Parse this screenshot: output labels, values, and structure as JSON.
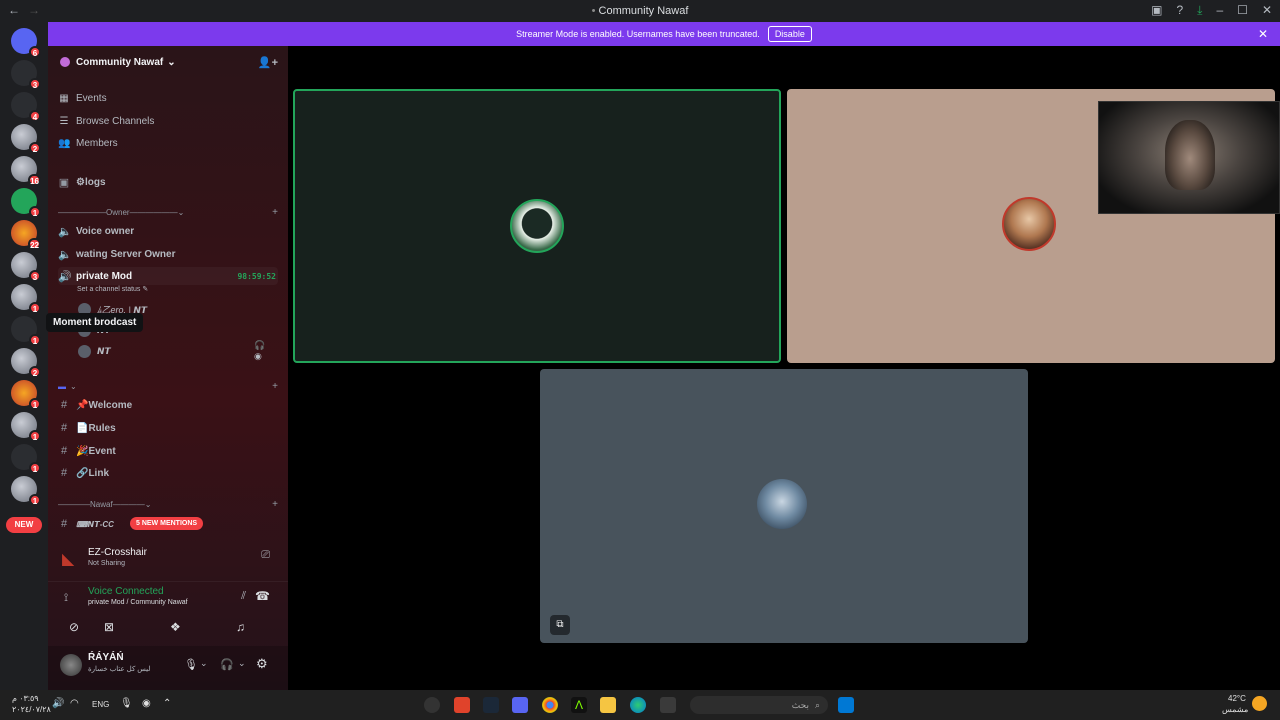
{
  "window": {
    "title": "Community Nawaf"
  },
  "banner": {
    "text": "Streamer Mode is enabled. Usernames have been truncated.",
    "button": "Disable"
  },
  "servers": {
    "badges": [
      "6",
      "3",
      "4",
      "2",
      "16",
      "1",
      "22",
      "3",
      "1",
      "1",
      "2",
      "1",
      "1",
      "1",
      "1"
    ],
    "new_label": "NEW",
    "tooltip": "Moment brodcast"
  },
  "sidebar": {
    "server_name": "Community Nawaf",
    "menu": [
      {
        "label": "Events",
        "icon": "calendar-icon"
      },
      {
        "label": "Browse Channels",
        "icon": "list-icon"
      },
      {
        "label": "Members",
        "icon": "members-icon"
      }
    ],
    "channels": {
      "logs": "⚙logs",
      "category_owner": "Owner",
      "voice_owner": "Voice owner",
      "waiting": "wating Server Owner",
      "private_mod": "private Mod",
      "timer": "98:59:52",
      "status_hint": "Set a channel status",
      "voice_users": [
        "ﾑ乙ero. | 𝙉𝙏",
        "𝙉𝙏",
        "𝙉𝙏"
      ],
      "welcome": "📌Welcome",
      "rules": "📄Rules",
      "event": "🎉Event",
      "link": "🔗Link",
      "category_nawaf": "Nawaf",
      "nt_channel": "⌨𝙉𝙏-CC",
      "mentions": "5 NEW MENTIONS"
    },
    "stream": {
      "name": "EZ-Crosshair",
      "status": "Not Sharing"
    },
    "voice": {
      "title": "Voice Connected",
      "subtitle": "private Mod / Community Nawaf"
    },
    "user": {
      "name": "ŔÁYÁŃ",
      "status": "ليس كل عتاب خسارة"
    }
  },
  "taskbar": {
    "time": "٠٣:٥٩ م",
    "date": "٢٠٢٤/٠٧/٢٨",
    "lang": "ENG",
    "search_placeholder": "بحث",
    "weather_temp": "42°C",
    "weather_desc": "مشمس"
  },
  "colors": {
    "accent": "#7c3aed",
    "discord": "#5865f2",
    "speaking": "#23a55a",
    "danger": "#f23f43"
  }
}
